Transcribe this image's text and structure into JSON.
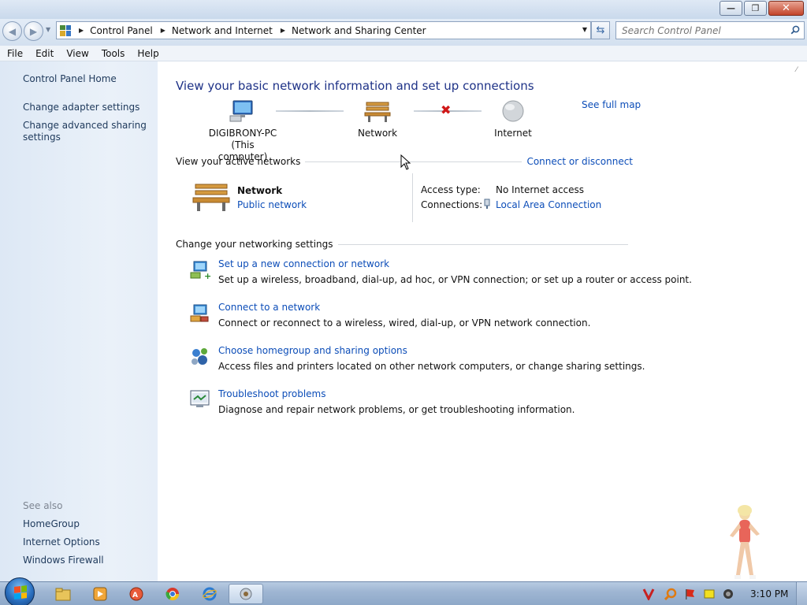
{
  "window": {
    "minimize_glyph": "—",
    "maximize_glyph": "❐",
    "close_glyph": "✕"
  },
  "address": {
    "breadcrumbs": [
      "Control Panel",
      "Network and Internet",
      "Network and Sharing Center"
    ],
    "search_placeholder": "Search Control Panel"
  },
  "menu": [
    "File",
    "Edit",
    "View",
    "Tools",
    "Help"
  ],
  "sidebar": {
    "home": "Control Panel Home",
    "links": [
      "Change adapter settings",
      "Change advanced sharing settings"
    ],
    "see_also_label": "See also",
    "see_also": [
      "HomeGroup",
      "Internet Options",
      "Windows Firewall"
    ]
  },
  "main": {
    "heading": "View your basic network information and set up connections",
    "see_full_map": "See full map",
    "map": {
      "computer_name": "DIGIBRONY-PC",
      "computer_sub": "(This computer)",
      "network": "Network",
      "internet": "Internet"
    },
    "active_networks_label": "View your active networks",
    "connect_disconnect": "Connect or disconnect",
    "network_name": "Network",
    "network_type": "Public network",
    "access_type_label": "Access type:",
    "access_type_value": "No Internet access",
    "connections_label": "Connections:",
    "connections_value": "Local Area Connection",
    "change_settings_label": "Change your networking settings",
    "tasks": [
      {
        "title": "Set up a new connection or network",
        "desc": "Set up a wireless, broadband, dial-up, ad hoc, or VPN connection; or set up a router or access point."
      },
      {
        "title": "Connect to a network",
        "desc": "Connect or reconnect to a wireless, wired, dial-up, or VPN network connection."
      },
      {
        "title": "Choose homegroup and sharing options",
        "desc": "Access files and printers located on other network computers, or change sharing settings."
      },
      {
        "title": "Troubleshoot problems",
        "desc": "Diagnose and repair network problems, or get troubleshooting information."
      }
    ]
  },
  "taskbar": {
    "apps": [
      "windows-explorer-icon",
      "media-player-icon",
      "pdf-reader-icon",
      "chrome-icon",
      "internet-explorer-icon",
      "network-center-icon"
    ],
    "clock": "3:10 PM"
  }
}
